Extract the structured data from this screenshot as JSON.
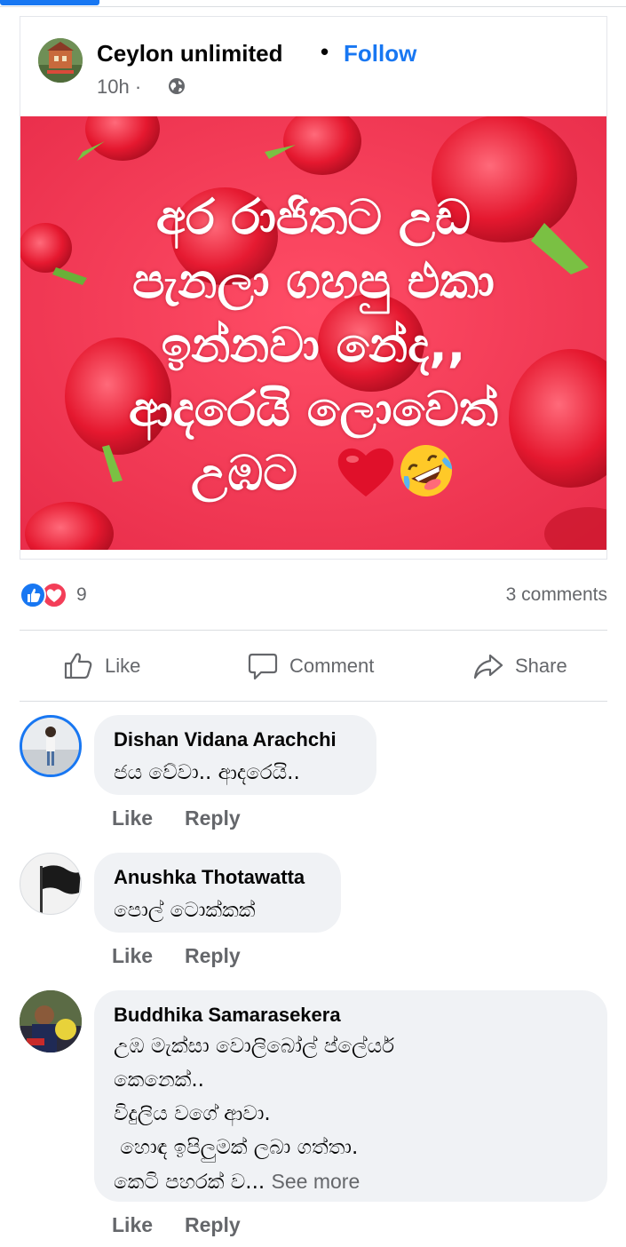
{
  "post": {
    "page_name": "Ceylon unlimited",
    "separator": "•",
    "follow_label": "Follow",
    "time": "10h ·",
    "privacy_icon": "globe-icon",
    "image_text_lines": [
      "අර රාජිතට උඩ",
      "පැනලා ගහපු එකා",
      "ඉන්නවා නේද,,",
      "ආදරෙයි ලොවෙත්",
      "උඹට"
    ],
    "image_emojis": [
      "red-heart",
      "rolling-laughing-face"
    ],
    "image_bg_color": "#f23a55"
  },
  "stats": {
    "reaction_count": "9",
    "comments_label": "3 comments"
  },
  "actions": {
    "like_label": "Like",
    "comment_label": "Comment",
    "share_label": "Share"
  },
  "comments": [
    {
      "name": "Dishan Vidana Arachchi",
      "lines": [
        "ජය වේවා.. ආදරෙයි.."
      ],
      "like_label": "Like",
      "reply_label": "Reply"
    },
    {
      "name": "Anushka Thotawatta",
      "lines": [
        "පොල් ටොක්කක්"
      ],
      "like_label": "Like",
      "reply_label": "Reply"
    },
    {
      "name": "Buddhika Samarasekera",
      "lines": [
        "උඹ මැක්සා වොලිබෝල් ප්ලේයර්",
        "කෙනෙක්..",
        "විදුලිය වගේ ආවා.",
        " හොඳ ඉපිලුමක් ලබා ගත්තා.",
        "කෙටි පහරක් ව..."
      ],
      "see_more": "See more",
      "like_label": "Like",
      "reply_label": "Reply"
    }
  ],
  "colors": {
    "accent": "#1877f2",
    "love": "#f33e58",
    "muted_text": "#65676b",
    "bubble_bg": "#f0f2f5"
  }
}
